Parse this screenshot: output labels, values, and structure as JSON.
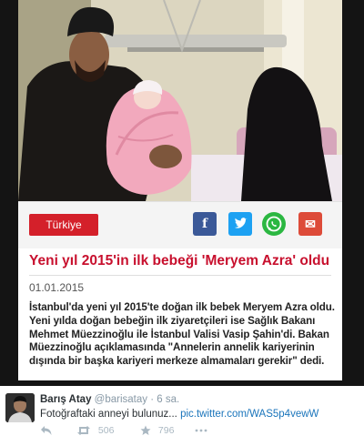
{
  "article": {
    "category_label": "Türkiye",
    "share_icons": [
      "facebook-icon",
      "twitter-icon",
      "whatsapp-icon",
      "mail-icon"
    ],
    "share_labels": {
      "facebook": "f",
      "twitter": "t",
      "mail": "✉"
    },
    "headline": "Yeni yıl 2015'in ilk bebeği 'Meryem Azra' oldu",
    "date": "01.01.2015",
    "body": "İstanbul'da yeni yıl 2015'te doğan ilk bebek Meryem Azra oldu. Yeni yılda doğan bebeğin ilk ziyaretçileri ise Sağlık Bakanı Mehmet Müezzinoğlu ile İstanbul Valisi Vasip Şahin'di. Bakan Müezzinoğlu açıklamasında \"Annelerin annelik kariyerinin dışında bir başka kariyeri merkeze almamaları gerekir\" dedi.",
    "colors": {
      "accent": "#c8102e",
      "category": "#d4202a",
      "facebook": "#3b5998",
      "twitter": "#1da1f2",
      "whatsapp": "#2bb741",
      "mail": "#dd4b39"
    }
  },
  "tweet": {
    "author_name": "Barış Atay",
    "handle": "@barisatay",
    "time": "· 6 sa.",
    "text": "Fotoğraftaki anneyi bulunuz... ",
    "link": "pic.twitter.com/WAS5p4vewW",
    "retweets": "506",
    "favorites": "796",
    "colors": {
      "link": "#1b75bb",
      "muted": "#8899a6"
    }
  }
}
